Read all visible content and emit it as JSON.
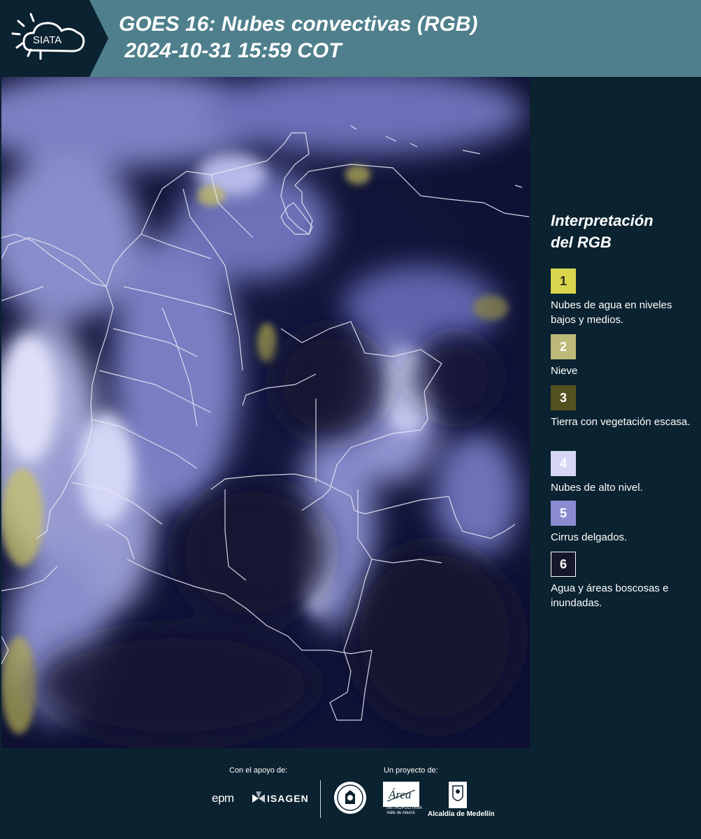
{
  "header": {
    "logo_text": "SIATA",
    "title_line1": "GOES 16: Nubes convectivas (RGB)",
    "title_line2": " 2024-10-31 15:59 COT"
  },
  "legend": {
    "title_line1": "Interpretación",
    "title_line2": "del RGB",
    "items": [
      {
        "number": "1",
        "label": "Nubes de agua en niveles bajos y medios.",
        "color": "#d9d44e",
        "text_color": "#2f2f1a"
      },
      {
        "number": "2",
        "label": "Nieve",
        "color": "#bdb978",
        "text_color": "#ffffff"
      },
      {
        "number": "3",
        "label": "Tierra con vegetación escasa.",
        "color": "#555020",
        "text_color": "#ffffff"
      },
      {
        "number": "4",
        "label": "Nubes de alto nivel.",
        "color": "#d6d6f5",
        "text_color": "#ffffff"
      },
      {
        "number": "5",
        "label": "Cirrus delgados.",
        "color": "#8b8bd2",
        "text_color": "#ffffff"
      },
      {
        "number": "6",
        "label": "Agua y áreas boscosas e inundadas.",
        "color": "#16162c",
        "text_color": "#ffffff"
      }
    ]
  },
  "footer": {
    "support_label": "Con el apoyo de:",
    "project_label": "Un proyecto de:",
    "epm": "epm",
    "isagen": "ISAGEN",
    "area_name": "Área",
    "area_sub1": "METROPOLITANA",
    "area_sub2": "Valle de Aburrá",
    "alcaldia": "Alcaldía de Medellín"
  },
  "colors": {
    "header_bg": "#4f7f8c",
    "page_bg": "#0b2230",
    "map_dark": "#0f1238",
    "cloud_high": "#b9bdf2",
    "cloud_low": "#c9c262"
  }
}
